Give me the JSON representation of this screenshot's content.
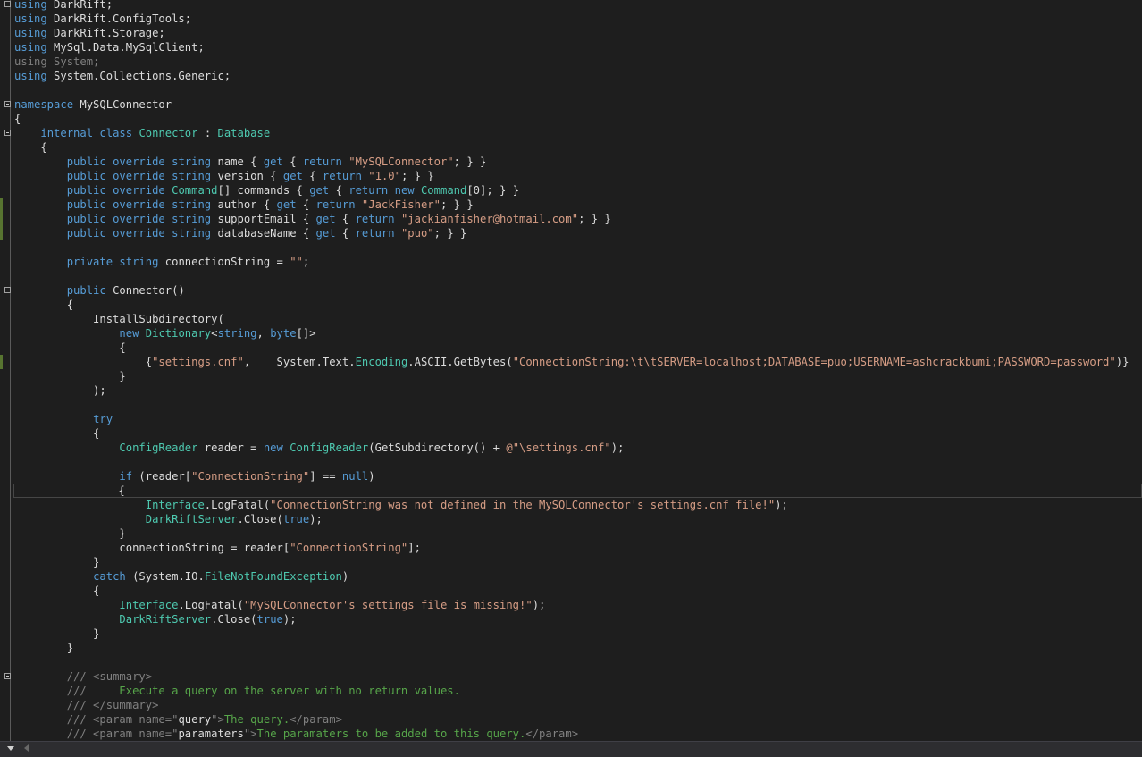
{
  "editor": {
    "lines": [
      [
        [
          "kw",
          "using"
        ],
        [
          "p",
          " DarkRift;"
        ]
      ],
      [
        [
          "kw",
          "using"
        ],
        [
          "p",
          " DarkRift.ConfigTools;"
        ]
      ],
      [
        [
          "kw",
          "using"
        ],
        [
          "p",
          " DarkRift.Storage;"
        ]
      ],
      [
        [
          "kw",
          "using"
        ],
        [
          "p",
          " MySql.Data.MySqlClient;"
        ]
      ],
      [
        [
          "dim",
          "using System;"
        ]
      ],
      [
        [
          "kw",
          "using"
        ],
        [
          "p",
          " System.Collections.Generic;"
        ]
      ],
      [],
      [
        [
          "kw",
          "namespace"
        ],
        [
          "p",
          " MySQLConnector"
        ]
      ],
      [
        [
          "p",
          "{"
        ]
      ],
      [
        [
          "p",
          "    "
        ],
        [
          "kw",
          "internal class"
        ],
        [
          "p",
          " "
        ],
        [
          "ty",
          "Connector"
        ],
        [
          "p",
          " : "
        ],
        [
          "ty",
          "Database"
        ]
      ],
      [
        [
          "p",
          "    {"
        ]
      ],
      [
        [
          "p",
          "        "
        ],
        [
          "kw",
          "public override string"
        ],
        [
          "p",
          " name { "
        ],
        [
          "kw",
          "get"
        ],
        [
          "p",
          " { "
        ],
        [
          "kw",
          "return"
        ],
        [
          "p",
          " "
        ],
        [
          "st",
          "\"MySQLConnector\""
        ],
        [
          "p",
          "; } }"
        ]
      ],
      [
        [
          "p",
          "        "
        ],
        [
          "kw",
          "public override string"
        ],
        [
          "p",
          " version { "
        ],
        [
          "kw",
          "get"
        ],
        [
          "p",
          " { "
        ],
        [
          "kw",
          "return"
        ],
        [
          "p",
          " "
        ],
        [
          "st",
          "\"1.0\""
        ],
        [
          "p",
          "; } }"
        ]
      ],
      [
        [
          "p",
          "        "
        ],
        [
          "kw",
          "public override"
        ],
        [
          "p",
          " "
        ],
        [
          "ty",
          "Command"
        ],
        [
          "p",
          "[] commands { "
        ],
        [
          "kw",
          "get"
        ],
        [
          "p",
          " { "
        ],
        [
          "kw",
          "return new"
        ],
        [
          "p",
          " "
        ],
        [
          "ty",
          "Command"
        ],
        [
          "p",
          "[0]; } }"
        ]
      ],
      [
        [
          "p",
          "        "
        ],
        [
          "kw",
          "public override string"
        ],
        [
          "p",
          " author { "
        ],
        [
          "kw",
          "get"
        ],
        [
          "p",
          " { "
        ],
        [
          "kw",
          "return"
        ],
        [
          "p",
          " "
        ],
        [
          "st",
          "\"JackFisher\""
        ],
        [
          "p",
          "; } }"
        ]
      ],
      [
        [
          "p",
          "        "
        ],
        [
          "kw",
          "public override string"
        ],
        [
          "p",
          " supportEmail { "
        ],
        [
          "kw",
          "get"
        ],
        [
          "p",
          " { "
        ],
        [
          "kw",
          "return"
        ],
        [
          "p",
          " "
        ],
        [
          "st",
          "\"jackianfisher@hotmail.com\""
        ],
        [
          "p",
          "; } }"
        ]
      ],
      [
        [
          "p",
          "        "
        ],
        [
          "kw",
          "public override string"
        ],
        [
          "p",
          " databaseName { "
        ],
        [
          "kw",
          "get"
        ],
        [
          "p",
          " { "
        ],
        [
          "kw",
          "return"
        ],
        [
          "p",
          " "
        ],
        [
          "st",
          "\"puo\""
        ],
        [
          "p",
          "; } }"
        ]
      ],
      [],
      [
        [
          "p",
          "        "
        ],
        [
          "kw",
          "private string"
        ],
        [
          "p",
          " connectionString = "
        ],
        [
          "st",
          "\"\""
        ],
        [
          "p",
          ";"
        ]
      ],
      [],
      [
        [
          "p",
          "        "
        ],
        [
          "kw",
          "public"
        ],
        [
          "p",
          " Connector()"
        ]
      ],
      [
        [
          "p",
          "        {"
        ]
      ],
      [
        [
          "p",
          "            InstallSubdirectory("
        ]
      ],
      [
        [
          "p",
          "                "
        ],
        [
          "kw",
          "new"
        ],
        [
          "p",
          " "
        ],
        [
          "ty",
          "Dictionary"
        ],
        [
          "p",
          "<"
        ],
        [
          "kw",
          "string"
        ],
        [
          "p",
          ", "
        ],
        [
          "kw",
          "byte"
        ],
        [
          "p",
          "[]>"
        ]
      ],
      [
        [
          "p",
          "                {"
        ]
      ],
      [
        [
          "p",
          "                    {"
        ],
        [
          "st",
          "\"settings.cnf\""
        ],
        [
          "p",
          ",    System.Text."
        ],
        [
          "ty",
          "Encoding"
        ],
        [
          "p",
          ".ASCII.GetBytes("
        ],
        [
          "st",
          "\"ConnectionString:\\t\\tSERVER=localhost;DATABASE=puo;USERNAME=ashcrackbumi;PASSWORD=password\""
        ],
        [
          "p",
          ")}"
        ]
      ],
      [
        [
          "p",
          "                }"
        ]
      ],
      [
        [
          "p",
          "            );"
        ]
      ],
      [],
      [
        [
          "p",
          "            "
        ],
        [
          "kw",
          "try"
        ]
      ],
      [
        [
          "p",
          "            {"
        ]
      ],
      [
        [
          "p",
          "                "
        ],
        [
          "ty",
          "ConfigReader"
        ],
        [
          "p",
          " reader = "
        ],
        [
          "kw",
          "new"
        ],
        [
          "p",
          " "
        ],
        [
          "ty",
          "ConfigReader"
        ],
        [
          "p",
          "(GetSubdirectory() + "
        ],
        [
          "st",
          "@\"\\settings.cnf\""
        ],
        [
          "p",
          ");"
        ]
      ],
      [],
      [
        [
          "p",
          "                "
        ],
        [
          "kw",
          "if"
        ],
        [
          "p",
          " (reader["
        ],
        [
          "st",
          "\"ConnectionString\""
        ],
        [
          "p",
          "] == "
        ],
        [
          "kw",
          "null"
        ],
        [
          "p",
          ")"
        ]
      ],
      [
        [
          "p",
          "                {"
        ]
      ],
      [
        [
          "p",
          "                    "
        ],
        [
          "ty",
          "Interface"
        ],
        [
          "p",
          ".LogFatal("
        ],
        [
          "st",
          "\"ConnectionString was not defined in the MySQLConnector's settings.cnf file!\""
        ],
        [
          "p",
          ");"
        ]
      ],
      [
        [
          "p",
          "                    "
        ],
        [
          "ty",
          "DarkRiftServer"
        ],
        [
          "p",
          ".Close("
        ],
        [
          "kw",
          "true"
        ],
        [
          "p",
          ");"
        ]
      ],
      [
        [
          "p",
          "                }"
        ]
      ],
      [
        [
          "p",
          "                connectionString = reader["
        ],
        [
          "st",
          "\"ConnectionString\""
        ],
        [
          "p",
          "];"
        ]
      ],
      [
        [
          "p",
          "            }"
        ]
      ],
      [
        [
          "p",
          "            "
        ],
        [
          "kw",
          "catch"
        ],
        [
          "p",
          " (System.IO."
        ],
        [
          "ty",
          "FileNotFoundException"
        ],
        [
          "p",
          ")"
        ]
      ],
      [
        [
          "p",
          "            {"
        ]
      ],
      [
        [
          "p",
          "                "
        ],
        [
          "ty",
          "Interface"
        ],
        [
          "p",
          ".LogFatal("
        ],
        [
          "st",
          "\"MySQLConnector's settings file is missing!\""
        ],
        [
          "p",
          ");"
        ]
      ],
      [
        [
          "p",
          "                "
        ],
        [
          "ty",
          "DarkRiftServer"
        ],
        [
          "p",
          ".Close("
        ],
        [
          "kw",
          "true"
        ],
        [
          "p",
          ");"
        ]
      ],
      [
        [
          "p",
          "            }"
        ]
      ],
      [
        [
          "p",
          "        }"
        ]
      ],
      [],
      [
        [
          "p",
          "        "
        ],
        [
          "xt",
          "/// <summary>"
        ]
      ],
      [
        [
          "p",
          "        "
        ],
        [
          "xt",
          "///"
        ],
        [
          "cm",
          "     Execute a query on the server with no return values."
        ]
      ],
      [
        [
          "p",
          "        "
        ],
        [
          "xt",
          "/// </summary>"
        ]
      ],
      [
        [
          "p",
          "        "
        ],
        [
          "xt",
          "/// <param name=\""
        ],
        [
          "p",
          "query"
        ],
        [
          "xt",
          "\">"
        ],
        [
          "cm",
          "The query."
        ],
        [
          "xt",
          "</param>"
        ]
      ],
      [
        [
          "p",
          "        "
        ],
        [
          "xt",
          "/// <param name=\""
        ],
        [
          "p",
          "paramaters"
        ],
        [
          "xt",
          "\">"
        ],
        [
          "cm",
          "The paramaters to be added to this query."
        ],
        [
          "xt",
          "</param>"
        ]
      ]
    ]
  },
  "colors": {
    "background": "#1e1e1e",
    "keyword": "#569cd6",
    "type": "#4ec9b0",
    "string": "#d69d85",
    "comment": "#57a64a",
    "xmldoc": "#808080",
    "text": "#dcdcdc",
    "changed": "#577430"
  },
  "statusbar": {
    "zoom_icon": "chevron-down-icon",
    "scroll_icon": "scroll-left-arrow-icon"
  }
}
